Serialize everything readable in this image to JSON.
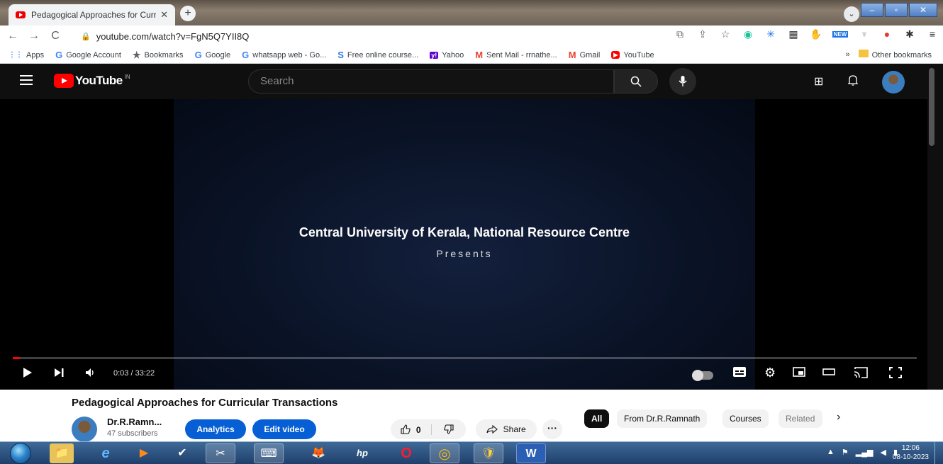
{
  "browser": {
    "tab_title": "Pedagogical Approaches for Curr",
    "tab_close": "✕",
    "new_tab": "+",
    "url": "youtube.com/watch?v=FgN5Q7YII8Q",
    "nav": {
      "back": "←",
      "forward": "→",
      "reload": "C"
    },
    "extensions": [
      "⧉",
      "⇪",
      "☆",
      "◉",
      "✳",
      "▦",
      "✋",
      "NEW",
      "♆",
      "●",
      "✱",
      "≡",
      "◫",
      "☻",
      "⋮"
    ],
    "window_controls": {
      "minimize": "–",
      "maximize": "▫",
      "close": "✕"
    },
    "profile_dropdown": "⌄"
  },
  "bookmarks": {
    "items": [
      {
        "icon": "⋮⋮",
        "label": "Apps",
        "color": "#4285f4"
      },
      {
        "icon": "G",
        "label": "Google Account",
        "color": "#4285f4"
      },
      {
        "icon": "★",
        "label": "Bookmarks",
        "color": "#5f6368"
      },
      {
        "icon": "G",
        "label": "Google",
        "color": "#4285f4"
      },
      {
        "icon": "G",
        "label": "whatsapp web - Go...",
        "color": "#4285f4"
      },
      {
        "icon": "S",
        "label": "Free online course...",
        "color": "#2d7de0"
      },
      {
        "icon": "y!",
        "label": "Yahoo",
        "color": "#6001d2"
      },
      {
        "icon": "M",
        "label": "Sent Mail - rrnathe...",
        "color": "#ea4335"
      },
      {
        "icon": "M",
        "label": "Gmail",
        "color": "#ea4335"
      },
      {
        "icon": "▶",
        "label": "YouTube",
        "color": "#ff0000"
      }
    ],
    "overflow": "»",
    "other_bookmarks": "Other bookmarks"
  },
  "youtube": {
    "logo_text": "YouTube",
    "country_code": "IN",
    "search_placeholder": "Search",
    "search_icon": "🔍",
    "mic_icon": "🎙",
    "create_icon": "⊞",
    "bell_icon": "🔔"
  },
  "player": {
    "overlay_title": "Central University of Kerala, National Resource Centre",
    "overlay_subtitle": "Presents",
    "time": "0:03 / 33:22",
    "progress_fraction": 0.0015,
    "controls": {
      "play": "▶",
      "next": "⏭",
      "volume": "🔈",
      "settings": "⚙",
      "miniplayer": "⧠",
      "theater": "▭",
      "cast": "⎚",
      "fullscreen": "⛶",
      "subtitles": "▤"
    }
  },
  "video": {
    "title": "Pedagogical Approaches for Curricular Transactions",
    "channel_name": "Dr.R.Ramn...",
    "subscribers": "47 subscribers",
    "analytics_label": "Analytics",
    "edit_label": "Edit video",
    "like_count": "0",
    "like_icon": "👍",
    "dislike_icon": "👎",
    "share_label": "Share",
    "more_label": "···"
  },
  "chips": [
    "All",
    "From Dr.R.Ramnath",
    "Courses",
    "Related"
  ],
  "chips_next": "›",
  "taskbar": {
    "clock_time": "12:06",
    "clock_date": "08-10-2023",
    "apps": [
      "📁",
      "e",
      "▶",
      "✔",
      "✂",
      "⌨",
      "🦊",
      "hp",
      "O",
      "◎",
      "🛡",
      "W"
    ]
  }
}
